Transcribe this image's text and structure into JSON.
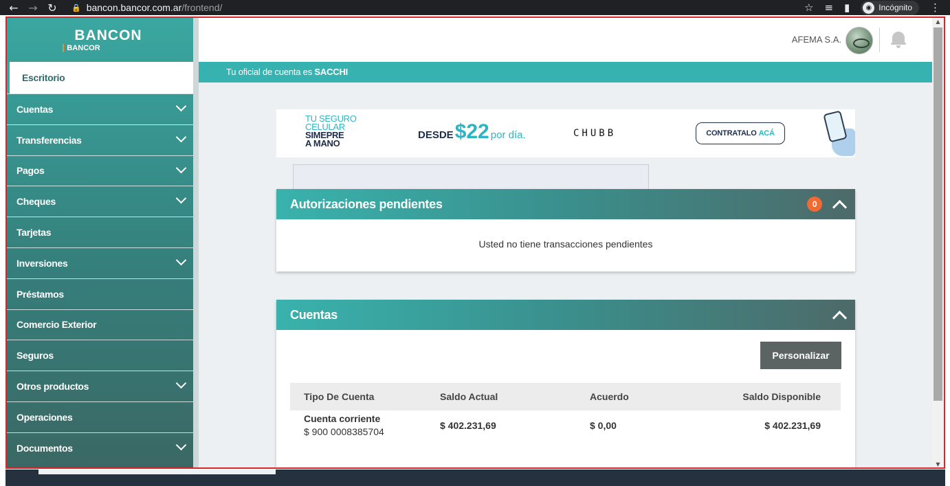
{
  "browser": {
    "url_host": "bancon.bancor.com.ar",
    "url_path": "/frontend/",
    "incognito_label": "Incógnito",
    "icons": [
      "back-icon",
      "forward-icon",
      "reload-icon",
      "lock-icon",
      "star-icon",
      "tab-search-icon",
      "sidebar-icon",
      "incognito-icon",
      "more-icon"
    ]
  },
  "brand": {
    "name": "BANCON",
    "sub": "BANCOR"
  },
  "sidebar": {
    "items": [
      {
        "label": "Escritorio",
        "expandable": false,
        "active": true
      },
      {
        "label": "Cuentas",
        "expandable": true
      },
      {
        "label": "Transferencias",
        "expandable": true
      },
      {
        "label": "Pagos",
        "expandable": true
      },
      {
        "label": "Cheques",
        "expandable": true
      },
      {
        "label": "Tarjetas",
        "expandable": false
      },
      {
        "label": "Inversiones",
        "expandable": true
      },
      {
        "label": "Préstamos",
        "expandable": false
      },
      {
        "label": "Comercio Exterior",
        "expandable": false
      },
      {
        "label": "Seguros",
        "expandable": false
      },
      {
        "label": "Otros productos",
        "expandable": true
      },
      {
        "label": "Operaciones",
        "expandable": false
      },
      {
        "label": "Documentos",
        "expandable": true
      }
    ]
  },
  "header": {
    "company": "AFEMA S.A.",
    "icons": [
      "avatar",
      "bell-icon"
    ]
  },
  "officer": {
    "prefix": "Tu oficial de cuenta es ",
    "name": "SACCHI"
  },
  "banner": {
    "line1": "TU SEGURO",
    "line2": "CELULAR",
    "line3": "SIMEPRE",
    "line4": "A MANO",
    "desde": "DESDE",
    "amount": "$22",
    "per": "por día.",
    "insurer": "CHUBB",
    "cta_main": "CONTRATALO",
    "cta_accent": "ACÁ"
  },
  "authorizations": {
    "title": "Autorizaciones pendientes",
    "count": "0",
    "empty_message": "Usted no tiene transacciones pendientes"
  },
  "accounts": {
    "title": "Cuentas",
    "customize_label": "Personalizar",
    "columns": [
      "Tipo De Cuenta",
      "Saldo Actual",
      "Acuerdo",
      "Saldo Disponible"
    ],
    "rows": [
      {
        "type": "Cuenta corriente",
        "number": "$ 900 0008385704",
        "current_balance": "$ 402.231,69",
        "agreement": "$ 0,00",
        "available_balance": "$ 402.231,69"
      }
    ]
  },
  "colors": {
    "teal": "#36b3b0",
    "badge": "#f06a32",
    "button": "#5b6363",
    "outline": "#d6252b"
  }
}
